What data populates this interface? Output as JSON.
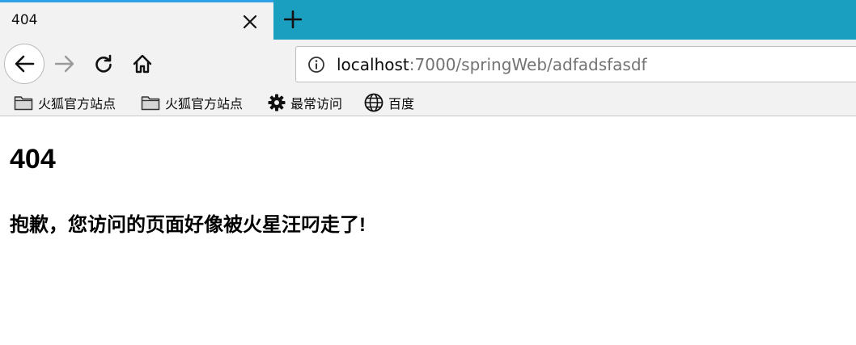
{
  "browser": {
    "tab": {
      "title": "404"
    },
    "url": {
      "host": "localhost",
      "path": ":7000/springWeb/adfadsfasdf"
    },
    "bookmarks": [
      {
        "label": "火狐官方站点",
        "icon": "folder-icon"
      },
      {
        "label": "火狐官方站点",
        "icon": "folder-icon"
      },
      {
        "label": "最常访问",
        "icon": "gear-icon"
      },
      {
        "label": "百度",
        "icon": "globe-icon"
      }
    ],
    "colors": {
      "tabstrip": "#1a9fc1",
      "active_tab": "#f2f2f2",
      "tab_accent": "#2fa2e6",
      "toolbar": "#f2f2f2"
    }
  },
  "page": {
    "heading": "404",
    "message": "抱歉，您访问的页面好像被火星汪叼走了!"
  }
}
